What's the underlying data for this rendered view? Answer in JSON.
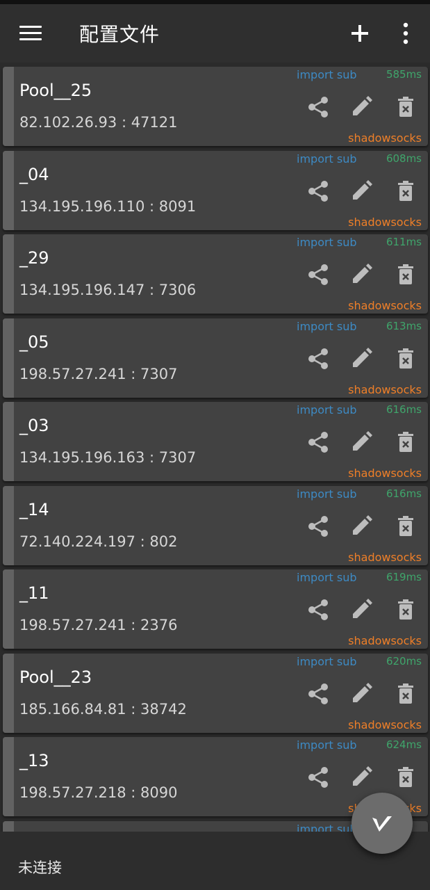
{
  "appbar": {
    "title": "配置文件",
    "menu_icon": "menu-icon",
    "add_icon": "add-icon",
    "more_icon": "more-vert-icon"
  },
  "servers": [
    {
      "name": "Pool__25",
      "address": "82.102.26.93 : 47121",
      "subscription": "import sub",
      "latency": "585ms",
      "type": "shadowsocks"
    },
    {
      "name": "_04",
      "address": "134.195.196.110 : 8091",
      "subscription": "import sub",
      "latency": "608ms",
      "type": "shadowsocks"
    },
    {
      "name": "_29",
      "address": "134.195.196.147 : 7306",
      "subscription": "import sub",
      "latency": "611ms",
      "type": "shadowsocks"
    },
    {
      "name": "_05",
      "address": "198.57.27.241 : 7307",
      "subscription": "import sub",
      "latency": "613ms",
      "type": "shadowsocks"
    },
    {
      "name": "_03",
      "address": "134.195.196.163 : 7307",
      "subscription": "import sub",
      "latency": "616ms",
      "type": "shadowsocks"
    },
    {
      "name": "_14",
      "address": "72.140.224.197 : 802",
      "subscription": "import sub",
      "latency": "616ms",
      "type": "shadowsocks"
    },
    {
      "name": "_11",
      "address": "198.57.27.241 : 2376",
      "subscription": "import sub",
      "latency": "619ms",
      "type": "shadowsocks"
    },
    {
      "name": "Pool__23",
      "address": "185.166.84.81 : 38742",
      "subscription": "import sub",
      "latency": "620ms",
      "type": "shadowsocks"
    },
    {
      "name": "_13",
      "address": "198.57.27.218 : 8090",
      "subscription": "import sub",
      "latency": "624ms",
      "type": "shadowsocks"
    },
    {
      "name": "",
      "address": "",
      "subscription": "import sub",
      "latency": "",
      "type": ""
    }
  ],
  "bottom": {
    "connection_status": "未连接"
  },
  "colors": {
    "subscription": "#3d8ac4",
    "latency": "#3fa56b",
    "type": "#ef7f28",
    "card": "#424242",
    "background": "#2b2b2b"
  }
}
